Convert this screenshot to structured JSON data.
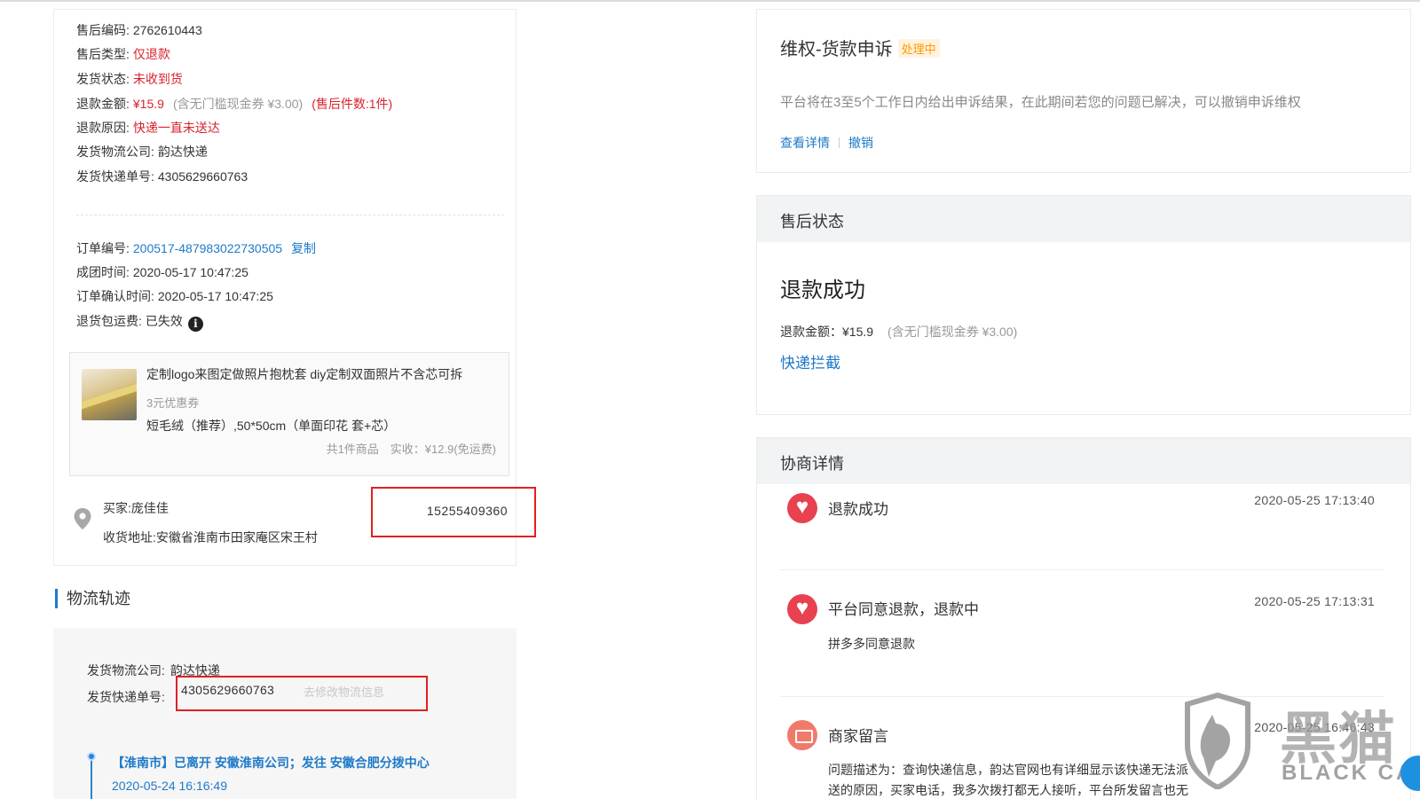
{
  "aftersale": {
    "rows": [
      {
        "label": "售后编码:",
        "value": "2762610443"
      },
      {
        "label": "售后类型:",
        "value": "仅退款"
      },
      {
        "label": "发货状态:",
        "value": "未收到货"
      },
      {
        "label": "退款金额:",
        "value": "¥15.9",
        "note": "(含无门槛现金券 ¥3.00)",
        "extra": "(售后件数:1件)"
      },
      {
        "label": "退款原因:",
        "value": "快递一直未送达"
      },
      {
        "label": "发货物流公司:",
        "value": "韵达快递"
      },
      {
        "label": "发货快递单号:",
        "value": "4305629660763"
      }
    ]
  },
  "order": {
    "number_label": "订单编号:",
    "number": "200517-487983022730505",
    "copy_label": "复制",
    "group_time_label": "成团时间:",
    "group_time": "2020-05-17 10:47:25",
    "confirm_time_label": "订单确认时间:",
    "confirm_time": "2020-05-17 10:47:25",
    "return_fee_label": "退货包运费:",
    "return_fee": "已失效"
  },
  "product": {
    "title": "定制logo来图定做照片抱枕套 diy定制双面照片不含芯可拆",
    "coupon": "3元优惠券",
    "spec": "短毛绒（推荐）,50*50cm（单面印花 套+芯）",
    "total": "共1件商品　实收：¥12.9(免运费)"
  },
  "buyer": {
    "name": "买家:庞佳佳",
    "address": "收货地址:安徽省淮南市田家庵区宋王村",
    "phone": "15255409360"
  },
  "logistics": {
    "section_title": "物流轨迹",
    "company_label": "发货物流公司:",
    "company": "韵达快递",
    "tracking_label": "发货快递单号:",
    "tracking": "4305629660763",
    "edit_link": "去修改物流信息",
    "timeline": [
      {
        "text": "【淮南市】已离开 安徽淮南公司；发往 安徽合肥分拨中心",
        "time": "2020-05-24 16:16:49"
      }
    ]
  },
  "appeal": {
    "title": "维权-货款申诉",
    "badge": "处理中",
    "desc": "平台将在3至5个工作日内给出申诉结果，在此期间若您的问题已解决，可以撤销申诉维权",
    "view_link": "查看详情",
    "cancel_link": "撤销"
  },
  "status": {
    "header": "售后状态",
    "result": "退款成功",
    "amount_label": "退款金额：¥15.9",
    "amount_note": "(含无门槛现金券 ¥3.00)",
    "intercept_link": "快递拦截"
  },
  "negotiation": {
    "header": "协商详情",
    "items": [
      {
        "icon": "heart-icon",
        "title": "退款成功",
        "time": "2020-05-25 17:13:40",
        "sub": ""
      },
      {
        "icon": "heart-icon",
        "title": "平台同意退款，退款中",
        "time": "2020-05-25 17:13:31",
        "sub": "拼多多同意退款"
      },
      {
        "icon": "message-icon",
        "title": "商家留言",
        "time": "2020-05-25 16:46:43",
        "sub": "问题描述为：查询快递信息，韵达官网也有详细显示该快递无法派",
        "sub2": "送的原因，买家电话，我多次拨打都无人接听，平台所发留言也无"
      }
    ]
  },
  "watermark": {
    "brand": "黑猫",
    "sub": "BLACK CAT"
  },
  "colors": {
    "link": "#1e7ac8",
    "warning_red": "#d9232e",
    "highlight_box": "#e02020",
    "badge_orange": "#ff9900"
  }
}
